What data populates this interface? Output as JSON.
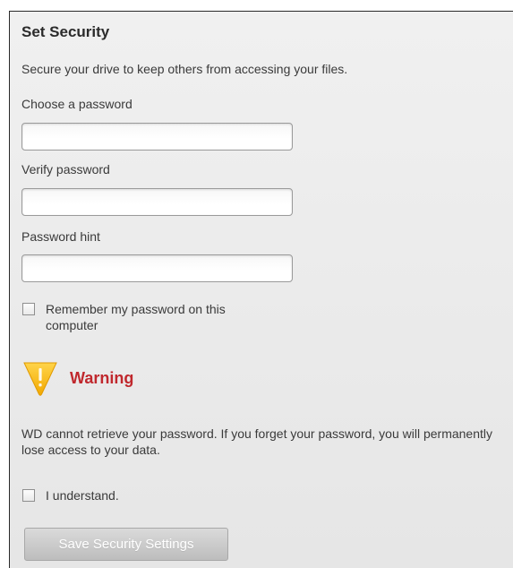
{
  "panel": {
    "title": "Set Security",
    "description": "Secure your drive to keep others from accessing your files."
  },
  "fields": {
    "password_label": "Choose a password",
    "password_value": "",
    "verify_label": "Verify password",
    "verify_value": "",
    "hint_label": "Password hint",
    "hint_value": ""
  },
  "remember": {
    "label": "Remember my password on this computer",
    "checked": false
  },
  "warning": {
    "icon": "warning-triangle-icon",
    "title": "Warning",
    "text": "WD cannot retrieve your password. If you forget your password, you will permanently lose access to your data.",
    "title_color": "#c0282d",
    "icon_color": "#f6b800"
  },
  "understand": {
    "label": "I understand.",
    "checked": false
  },
  "actions": {
    "save_label": "Save Security Settings",
    "save_enabled": false
  }
}
